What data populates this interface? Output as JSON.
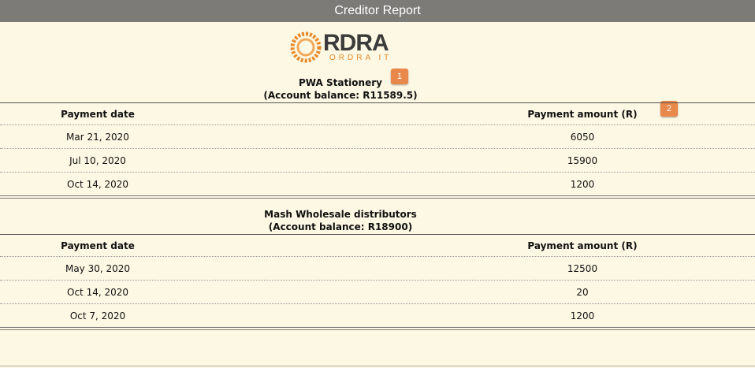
{
  "window": {
    "title": "Creditor Report"
  },
  "logo": {
    "text": "RDRA",
    "subtext": "ORDRA IT",
    "ring_color": "#e78a2c"
  },
  "badges": [
    "1",
    "2"
  ],
  "columns": {
    "date": "Payment date",
    "amount": "Payment amount (R)"
  },
  "creditors": [
    {
      "name": "PWA Stationery",
      "balance": "(Account balance: R11589.5)",
      "payments": [
        {
          "date": "Mar 21, 2020",
          "amount": "6050"
        },
        {
          "date": "Jul 10, 2020",
          "amount": "15900"
        },
        {
          "date": "Oct 14, 2020",
          "amount": "1200"
        }
      ]
    },
    {
      "name": "Mash Wholesale distributors",
      "balance": "(Account balance: R18900)",
      "payments": [
        {
          "date": "May 30, 2020",
          "amount": "12500"
        },
        {
          "date": "Oct 14, 2020",
          "amount": "20"
        },
        {
          "date": "Oct 7, 2020",
          "amount": "1200"
        }
      ]
    }
  ],
  "colors": {
    "background": "#fdf8e3",
    "titlebar": "#7c7b78",
    "badge": "#e8884a"
  }
}
